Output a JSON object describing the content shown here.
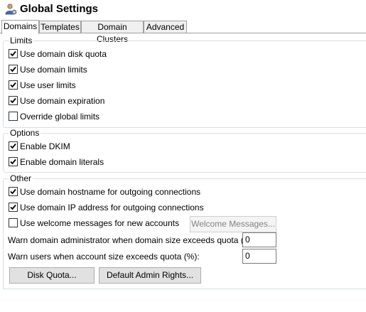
{
  "window": {
    "title": "Global Settings"
  },
  "tabs": [
    {
      "label": "Domains",
      "active": true
    },
    {
      "label": "Templates",
      "active": false
    },
    {
      "label": "Domain Clusters",
      "active": false
    },
    {
      "label": "Advanced",
      "active": false
    }
  ],
  "limits": {
    "label": "Limits",
    "items": [
      {
        "label": "Use domain disk quota",
        "checked": true
      },
      {
        "label": "Use domain limits",
        "checked": true
      },
      {
        "label": "Use user limits",
        "checked": true
      },
      {
        "label": "Use domain expiration",
        "checked": true
      },
      {
        "label": "Override global limits",
        "checked": false
      }
    ]
  },
  "options": {
    "label": "Options",
    "items": [
      {
        "label": "Enable DKIM",
        "checked": true
      },
      {
        "label": "Enable domain literals",
        "checked": true
      }
    ]
  },
  "other": {
    "label": "Other",
    "items": [
      {
        "label": "Use domain hostname for outgoing connections",
        "checked": true
      },
      {
        "label": "Use domain IP address for outgoing connections",
        "checked": true
      },
      {
        "label": "Use welcome messages for new accounts",
        "checked": false
      }
    ],
    "welcome_button": "Welcome Messages...",
    "warn_admin_label": "Warn domain administrator when domain size exceeds quota (%):",
    "warn_admin_value": "0",
    "warn_users_label": "Warn users when account size exceeds quota (%):",
    "warn_users_value": "0",
    "disk_quota_button": "Disk Quota...",
    "admin_rights_button": "Default Admin Rights..."
  }
}
